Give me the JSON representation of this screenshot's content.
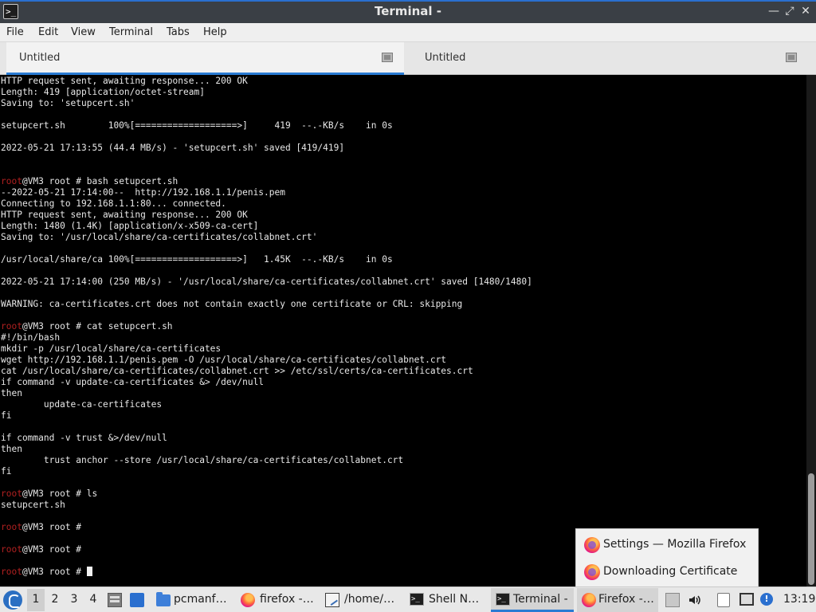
{
  "window": {
    "title": "Terminal -",
    "icon": "terminal-icon",
    "controls": [
      "minimize-icon",
      "maximize-icon",
      "close-icon"
    ]
  },
  "menu": [
    "File",
    "Edit",
    "View",
    "Terminal",
    "Tabs",
    "Help"
  ],
  "tabs": [
    {
      "label": "Untitled",
      "active": true
    },
    {
      "label": "Untitled",
      "active": false
    }
  ],
  "terminal": {
    "lines": [
      {
        "prompt": "",
        "text": "HTTP request sent, awaiting response... 200 OK"
      },
      {
        "prompt": "",
        "text": "Length: 419 [application/octet-stream]"
      },
      {
        "prompt": "",
        "text": "Saving to: 'setupcert.sh'"
      },
      {
        "prompt": "",
        "text": ""
      },
      {
        "prompt": "",
        "text": "setupcert.sh        100%[===================>]     419  --.-KB/s    in 0s"
      },
      {
        "prompt": "",
        "text": ""
      },
      {
        "prompt": "",
        "text": "2022-05-21 17:13:55 (44.4 MB/s) - 'setupcert.sh' saved [419/419]"
      },
      {
        "prompt": "",
        "text": ""
      },
      {
        "prompt": "",
        "text": ""
      },
      {
        "prompt": "root",
        "text": "@VM3 root # bash setupcert.sh"
      },
      {
        "prompt": "",
        "text": "--2022-05-21 17:14:00--  http://192.168.1.1/penis.pem"
      },
      {
        "prompt": "",
        "text": "Connecting to 192.168.1.1:80... connected."
      },
      {
        "prompt": "",
        "text": "HTTP request sent, awaiting response... 200 OK"
      },
      {
        "prompt": "",
        "text": "Length: 1480 (1.4K) [application/x-x509-ca-cert]"
      },
      {
        "prompt": "",
        "text": "Saving to: '/usr/local/share/ca-certificates/collabnet.crt'"
      },
      {
        "prompt": "",
        "text": ""
      },
      {
        "prompt": "",
        "text": "/usr/local/share/ca 100%[===================>]   1.45K  --.-KB/s    in 0s"
      },
      {
        "prompt": "",
        "text": ""
      },
      {
        "prompt": "",
        "text": "2022-05-21 17:14:00 (250 MB/s) - '/usr/local/share/ca-certificates/collabnet.crt' saved [1480/1480]"
      },
      {
        "prompt": "",
        "text": ""
      },
      {
        "prompt": "",
        "text": "WARNING: ca-certificates.crt does not contain exactly one certificate or CRL: skipping"
      },
      {
        "prompt": "",
        "text": ""
      },
      {
        "prompt": "root",
        "text": "@VM3 root # cat setupcert.sh"
      },
      {
        "prompt": "",
        "text": "#!/bin/bash"
      },
      {
        "prompt": "",
        "text": "mkdir -p /usr/local/share/ca-certificates"
      },
      {
        "prompt": "",
        "text": "wget http://192.168.1.1/penis.pem -O /usr/local/share/ca-certificates/collabnet.crt"
      },
      {
        "prompt": "",
        "text": "cat /usr/local/share/ca-certificates/collabnet.crt >> /etc/ssl/certs/ca-certificates.crt"
      },
      {
        "prompt": "",
        "text": "if command -v update-ca-certificates &> /dev/null"
      },
      {
        "prompt": "",
        "text": "then"
      },
      {
        "prompt": "",
        "text": "        update-ca-certificates"
      },
      {
        "prompt": "",
        "text": "fi"
      },
      {
        "prompt": "",
        "text": ""
      },
      {
        "prompt": "",
        "text": "if command -v trust &>/dev/null"
      },
      {
        "prompt": "",
        "text": "then"
      },
      {
        "prompt": "",
        "text": "        trust anchor --store /usr/local/share/ca-certificates/collabnet.crt"
      },
      {
        "prompt": "",
        "text": "fi"
      },
      {
        "prompt": "",
        "text": ""
      },
      {
        "prompt": "root",
        "text": "@VM3 root # ls"
      },
      {
        "prompt": "",
        "text": "setupcert.sh"
      },
      {
        "prompt": "",
        "text": ""
      },
      {
        "prompt": "root",
        "text": "@VM3 root #"
      },
      {
        "prompt": "",
        "text": ""
      },
      {
        "prompt": "root",
        "text": "@VM3 root #"
      },
      {
        "prompt": "",
        "text": ""
      },
      {
        "prompt": "root",
        "text": "@VM3 root # ",
        "cursor": true
      }
    ]
  },
  "popup": {
    "items": [
      "Settings — Mozilla Firefox",
      "Downloading Certificate"
    ]
  },
  "taskbar": {
    "desktops": [
      "1",
      "2",
      "3",
      "4"
    ],
    "tasks": [
      {
        "label": "pcmanf…",
        "icon": "folder-icon"
      },
      {
        "label": "firefox -…",
        "icon": "firefox-icon"
      },
      {
        "label": "/home/…",
        "icon": "text-editor-icon"
      },
      {
        "label": "Shell N…",
        "icon": "terminal-icon"
      },
      {
        "label": "Terminal -",
        "icon": "terminal-icon",
        "active": true
      },
      {
        "label": "Firefox -…",
        "icon": "firefox-icon",
        "active": true
      }
    ],
    "clock": "13:19"
  }
}
